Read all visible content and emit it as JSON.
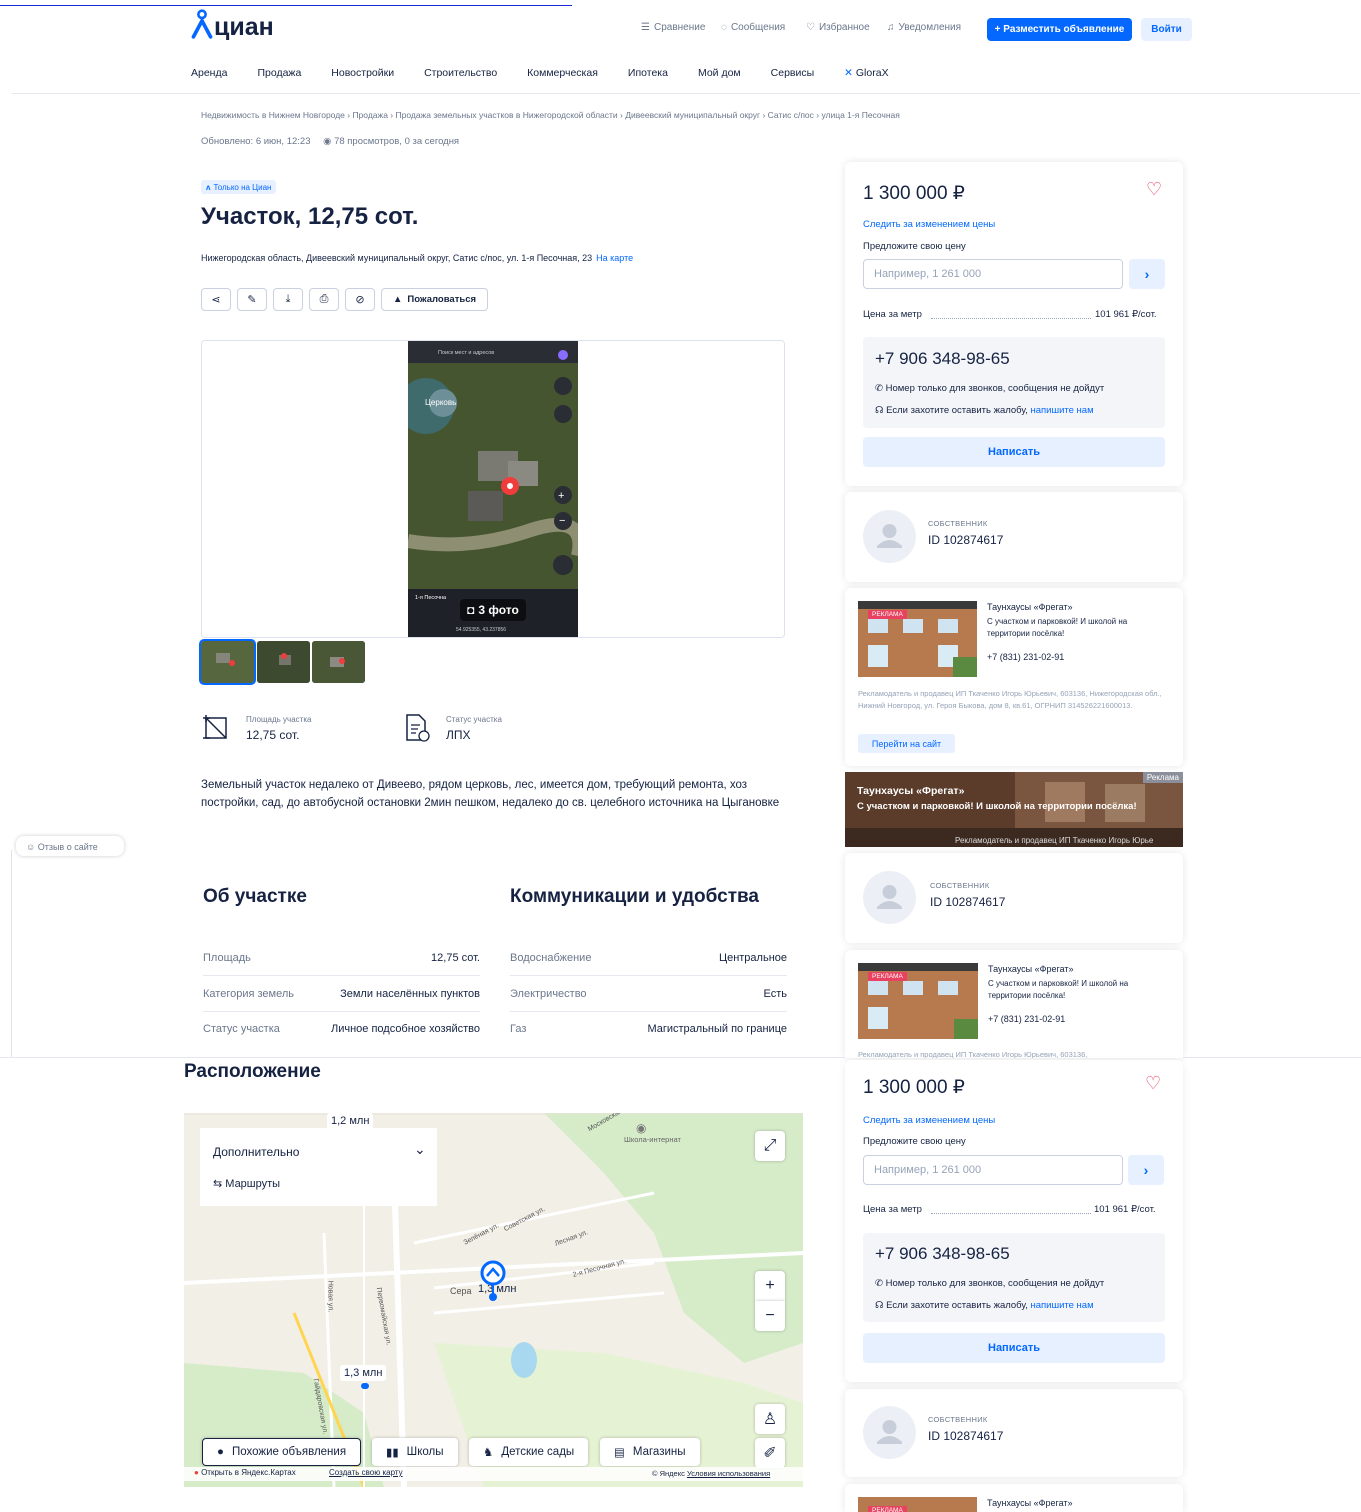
{
  "top_link": "",
  "header": {
    "logo": "циан",
    "links": [
      "Сравнение",
      "Сообщения",
      "Избранное",
      "Уведомления"
    ],
    "post_button": "+ Разместить объявление",
    "login_button": "Войти"
  },
  "nav": [
    "Аренда",
    "Продажа",
    "Новостройки",
    "Строительство",
    "Коммерческая",
    "Ипотека",
    "Мой дом",
    "Сервисы",
    "GloraX"
  ],
  "breadcrumbs": "Недвижимость в Нижнем Новгороде  ›  Продажа  ›  Продажа земельных участков в Нижегородской области  ›  Дивеевский муниципальный округ  ›  Сатис с/пос  ›  улица 1-я Песочная",
  "updated": "Обновлено: 6 июн, 12:23",
  "views": "78 просмотров, 0 за сегодня",
  "badge": "Только на Циан",
  "title": "Участок, 12,75 сот.",
  "address": "Нижегородская область, Дивеевский муниципальный округ, Сатис с/пос, ул. 1-я Песочная, 23",
  "on_map": "На карте",
  "complain": "Пожаловаться",
  "gallery": {
    "photo_count": "3 фото",
    "search_placeholder": "Поиск мест и адресов",
    "church_label": "Церковь",
    "coords": "54.925355, 43.237856",
    "street_label": "1-я Песочна"
  },
  "facts": [
    {
      "label": "Площадь участка",
      "value": "12,75 сот."
    },
    {
      "label": "Статус участка",
      "value": "ЛПХ"
    }
  ],
  "description": "Земельный участок недалеко от Дивеево, рядом церковь, лес, имеется дом, требующий ремонта, хоз постройки, сад, до автобусной остановки 2мин пешком, недалеко до св. целебного источника на Цыгановке",
  "feedback": "Отзыв о сайте",
  "about": {
    "title": "Об участке",
    "rows": [
      {
        "k": "Площадь",
        "v": "12,75 сот."
      },
      {
        "k": "Категория земель",
        "v": "Земли населённых пунктов"
      },
      {
        "k": "Статус участка",
        "v": "Личное подсобное хозяйство"
      }
    ]
  },
  "utilities": {
    "title": "Коммуникации и удобства",
    "rows": [
      {
        "k": "Водоснабжение",
        "v": "Центральное"
      },
      {
        "k": "Электричество",
        "v": "Есть"
      },
      {
        "k": "Газ",
        "v": "Магистральный по границе"
      }
    ]
  },
  "location": {
    "title": "Расположение",
    "panel_title": "Дополнительно",
    "routes": "Маршруты",
    "pins": [
      "1,2 млн",
      "1,3 млн",
      "1,3 млн"
    ],
    "street_labels": [
      "Зелёная ул.",
      "Советская ул.",
      "Лесная ул.",
      "2-я Песочная ул.",
      "Первомайская ул.",
      "Новая ул.",
      "Гайдаровская ул.",
      "Московская"
    ],
    "poi": "Школа-интернат",
    "chips": [
      "Похожие объявления",
      "Школы",
      "Детские сады",
      "Магазины"
    ],
    "open_yandex": "Открыть в Яндекс.Картах",
    "create_map": "Создать свою карту",
    "copyright": "© Яндекс",
    "terms": "Условия использования"
  },
  "price_card": {
    "price": "1 300 000 ₽",
    "track": "Следить за изменением цены",
    "offer_label": "Предложите свою цену",
    "offer_placeholder": "Например, 1 261 000",
    "per_meter_label": "Цена за метр",
    "per_meter_value": "101 961 ₽/сот.",
    "phone": "+7 906 348-98-65",
    "phone_note": "Номер только для звонков, сообщения не дойдут",
    "complaint_note": "Если захотите оставить жалобу,",
    "complaint_link": "напишите нам",
    "write": "Написать"
  },
  "owner": {
    "label": "СОБСТВЕННИК",
    "id": "ID 102874617"
  },
  "ad": {
    "tag": "РЕКЛАМА",
    "title": "Таунхаусы «Фрегат»",
    "text": "С участком и парковкой! И школой на территории посёлка!",
    "phone": "+7 (831) 231-02-91",
    "legal": "Рекламодатель и продавец ИП Ткаченко Игорь Юрьевич, 603136, Нижегородская обл., Нижний Новгород, ул. Героя Быкова, дом 8, кв.61, ОГРНИП 314526221600013.",
    "legal_short": "Рекламодатель и продавец ИП Ткаченко Игорь Юрьевич, 603136,",
    "button": "Перейти на сайт"
  },
  "banner": {
    "tag": "Реклама",
    "title": "Таунхаусы «Фрегат»",
    "subtitle": "С участком и парковкой! И школой на территории посёлка!",
    "footer": "Рекламодатель и продавец ИП Ткаченко Игорь Юрье"
  },
  "colors": {
    "accent": "#0468ff",
    "heart": "#e84260",
    "text": "#152242"
  }
}
